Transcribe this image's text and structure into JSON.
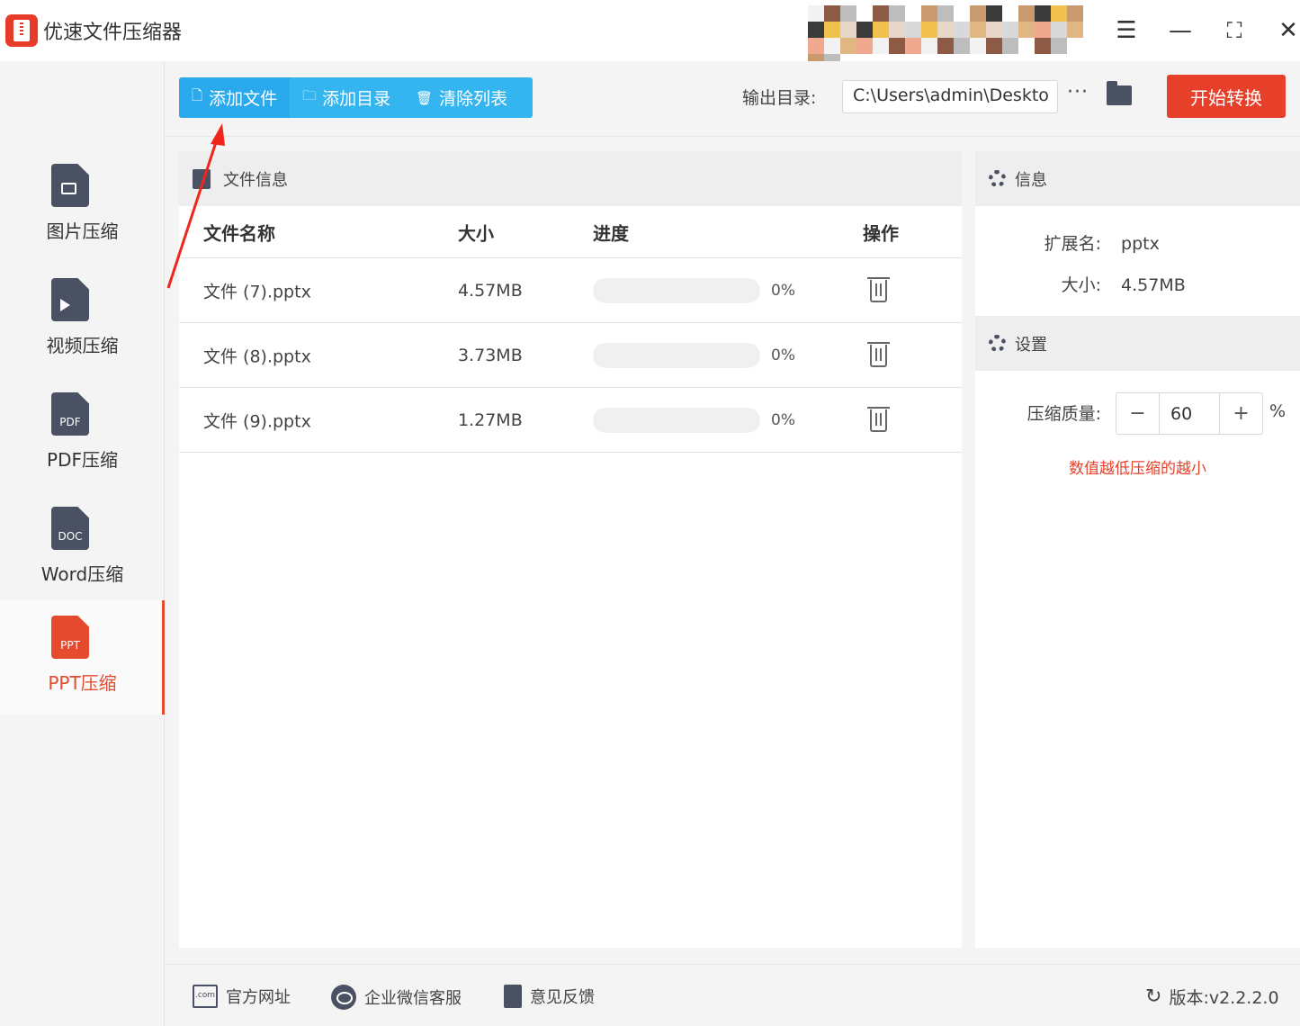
{
  "app": {
    "title": "优速文件压缩器"
  },
  "window_controls": {
    "menu": "☰",
    "minimize": "—",
    "maximize": "⛶",
    "close": "✕"
  },
  "sidebar": {
    "items": [
      {
        "label": "图片压缩",
        "icon": "image-file-icon",
        "badge": ""
      },
      {
        "label": "视频压缩",
        "icon": "video-file-icon",
        "badge": ""
      },
      {
        "label": "PDF压缩",
        "icon": "pdf-file-icon",
        "badge": "PDF"
      },
      {
        "label": "Word压缩",
        "icon": "doc-file-icon",
        "badge": "DOC"
      },
      {
        "label": "PPT压缩",
        "icon": "ppt-file-icon",
        "badge": "PPT",
        "active": true
      }
    ]
  },
  "toolbar": {
    "add_file": "添加文件",
    "add_dir": "添加目录",
    "clear_list": "清除列表",
    "output_label": "输出目录:",
    "output_path": "C:\\Users\\admin\\Deskto",
    "more": "···",
    "start": "开始转换"
  },
  "file_panel": {
    "title": "文件信息",
    "columns": [
      "文件名称",
      "大小",
      "进度",
      "操作"
    ],
    "rows": [
      {
        "name": "文件 (7).pptx",
        "size": "4.57MB",
        "progress_pct": "0%",
        "progress": 0
      },
      {
        "name": "文件 (8).pptx",
        "size": "3.73MB",
        "progress_pct": "0%",
        "progress": 0
      },
      {
        "name": "文件 (9).pptx",
        "size": "1.27MB",
        "progress_pct": "0%",
        "progress": 0
      }
    ]
  },
  "info_panel": {
    "title": "信息",
    "ext_label": "扩展名:",
    "ext_value": "pptx",
    "size_label": "大小:",
    "size_value": "4.57MB"
  },
  "settings_panel": {
    "title": "设置",
    "quality_label": "压缩质量:",
    "quality_value": "60",
    "minus": "−",
    "plus": "+",
    "unit": "%",
    "hint": "数值越低压缩的越小"
  },
  "footer": {
    "website": "官方网址",
    "wechat": "企业微信客服",
    "feedback": "意见反馈",
    "version": "版本:v2.2.2.0"
  },
  "colors": {
    "accent_blue": "#35b5ef",
    "accent_red": "#e64a2e",
    "icon_gray": "#4a5163"
  }
}
